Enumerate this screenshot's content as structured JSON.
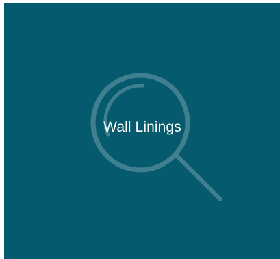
{
  "tile": {
    "label": "Wall Linings",
    "background_color": "#065a6d",
    "icon": "search-icon"
  }
}
